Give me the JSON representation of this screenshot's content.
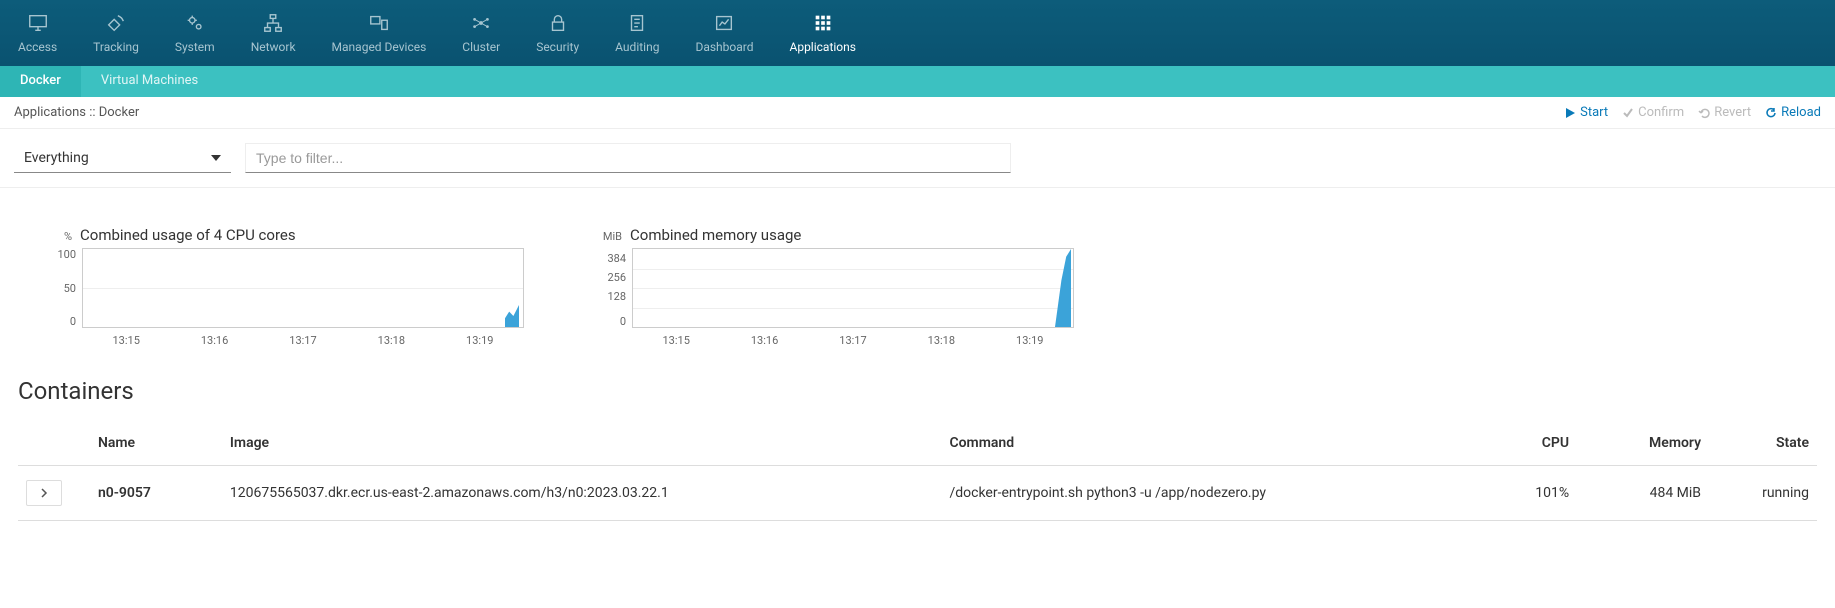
{
  "topnav": [
    {
      "label": "Access",
      "name": "nav-access"
    },
    {
      "label": "Tracking",
      "name": "nav-tracking"
    },
    {
      "label": "System",
      "name": "nav-system"
    },
    {
      "label": "Network",
      "name": "nav-network"
    },
    {
      "label": "Managed Devices",
      "name": "nav-managed-devices"
    },
    {
      "label": "Cluster",
      "name": "nav-cluster"
    },
    {
      "label": "Security",
      "name": "nav-security"
    },
    {
      "label": "Auditing",
      "name": "nav-auditing"
    },
    {
      "label": "Dashboard",
      "name": "nav-dashboard"
    },
    {
      "label": "Applications",
      "name": "nav-applications",
      "active": true
    }
  ],
  "subtabs": [
    {
      "label": "Docker",
      "active": true
    },
    {
      "label": "Virtual Machines"
    }
  ],
  "breadcrumb": "Applications :: Docker",
  "actions": {
    "start": "Start",
    "confirm": "Confirm",
    "revert": "Revert",
    "reload": "Reload"
  },
  "filter": {
    "select_value": "Everything",
    "input_placeholder": "Type to filter..."
  },
  "containers": {
    "title": "Containers",
    "headers": {
      "name": "Name",
      "image": "Image",
      "command": "Command",
      "cpu": "CPU",
      "memory": "Memory",
      "state": "State"
    },
    "rows": [
      {
        "name": "n0-9057",
        "image": "120675565037.dkr.ecr.us-east-2.amazonaws.com/h3/n0:2023.03.22.1",
        "command": "/docker-entrypoint.sh python3 -u /app/nodezero.py",
        "cpu": "101%",
        "memory": "484 MiB",
        "state": "running"
      }
    ]
  },
  "chart_data": [
    {
      "type": "area",
      "title": "Combined usage of 4 CPU cores",
      "unit": "%",
      "ylim": [
        0,
        100
      ],
      "yticks": [
        0,
        50,
        100
      ],
      "xticks": [
        "13:15",
        "13:16",
        "13:17",
        "13:18",
        "13:19"
      ],
      "series": [
        {
          "name": "cpu",
          "values_approx": [
            0,
            0,
            0,
            0,
            0,
            0,
            0,
            0,
            0,
            0,
            0,
            0,
            0,
            0,
            0,
            0,
            0,
            0,
            0,
            0,
            0,
            0,
            0,
            0,
            8,
            25,
            18,
            30
          ],
          "note": "spike at right edge ~13:19.8"
        }
      ]
    },
    {
      "type": "area",
      "title": "Combined memory usage",
      "unit": "MiB",
      "ylim": [
        0,
        512
      ],
      "yticks": [
        0,
        128,
        256,
        384
      ],
      "xticks": [
        "13:15",
        "13:16",
        "13:17",
        "13:18",
        "13:19"
      ],
      "series": [
        {
          "name": "memory",
          "values_approx": [
            0,
            0,
            0,
            0,
            0,
            0,
            0,
            0,
            0,
            0,
            0,
            0,
            0,
            0,
            0,
            0,
            0,
            0,
            0,
            0,
            0,
            0,
            0,
            0,
            50,
            180,
            320,
            484
          ],
          "note": "steep rise at right edge to ~484 MiB"
        }
      ]
    }
  ]
}
